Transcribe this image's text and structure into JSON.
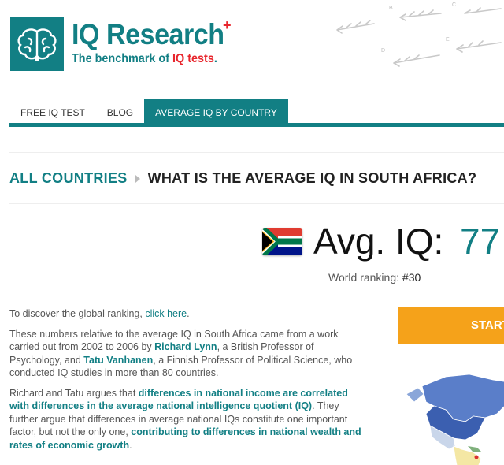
{
  "brand": {
    "name": "IQ Research",
    "plus": "+",
    "tagline_prefix": "The benchmark of ",
    "tagline_emphasis": "IQ tests",
    "tagline_suffix": "."
  },
  "nav": {
    "items": [
      {
        "label": "FREE IQ TEST"
      },
      {
        "label": "BLOG"
      },
      {
        "label": "AVERAGE IQ BY COUNTRY",
        "active": true
      }
    ]
  },
  "breadcrumb": {
    "link": "ALL COUNTRIES",
    "current": "WHAT IS THE AVERAGE IQ IN SOUTH AFRICA?"
  },
  "stats": {
    "avg_label": "Avg. IQ:",
    "avg_value": "77",
    "ranking_label": "World ranking: ",
    "ranking_value": "#30"
  },
  "content": {
    "p1_text": "To discover the global ranking, ",
    "p1_link": "click here",
    "p1_end": ".",
    "p2_a": "These numbers relative to the average IQ in South Africa came from a work carried out from 2002 to 2006 by ",
    "p2_name1": "Richard Lynn",
    "p2_b": ", a British Professor of Psychology, and ",
    "p2_name2": "Tatu Vanhanen",
    "p2_c": ", a Finnish Professor of Political Science, who conducted IQ studies in more than 80 countries.",
    "p3_a": "Richard and Tatu argues that ",
    "p3_b1": "differences in national income are correlated with differences in the average national intelligence quotient (IQ)",
    "p3_c": ". They further argue that differences in average national IQs constitute one important factor, but not the only one, ",
    "p3_b2": "contributing to differences in national wealth and rates of economic growth",
    "p3_d": "."
  },
  "cta": {
    "label": "START"
  },
  "colors": {
    "brand": "#127f84",
    "accent": "#e8262d",
    "cta": "#f5a21a"
  },
  "icons": {
    "logo": "brain-icon",
    "breadcrumb_separator": "triangle-right-icon",
    "flag": "south-africa-flag-icon"
  }
}
